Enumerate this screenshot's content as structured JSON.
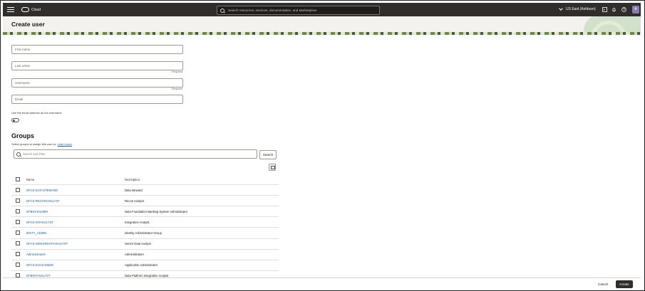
{
  "topbar": {
    "brand": "Cloud",
    "search_placeholder": "Search resources, services, documentation, and Marketplace",
    "region": "US East (Ashburn)",
    "avatar_initial": "A"
  },
  "page": {
    "title": "Create user"
  },
  "form": {
    "first_name_placeholder": "First name",
    "last_name_placeholder": "Last name",
    "last_name_required": "Required",
    "username_placeholder": "Username",
    "username_required": "Required",
    "email_placeholder": "Email",
    "use_email_label": "Use the email address as the username",
    "use_email_toggle_on": false
  },
  "groups": {
    "title": "Groups",
    "subtitle": "Select groups to assign this user to.",
    "learn_more": "Learn more",
    "search_placeholder": "Search and Filter",
    "search_button": "Search",
    "columns": {
      "name": "Name",
      "description": "Description"
    },
    "rows": [
      {
        "name": "DFCS-DATASTEWARD",
        "description": "Data steward"
      },
      {
        "name": "DFCS-RECONANALYST",
        "description": "Recon Analyst"
      },
      {
        "name": "DFBSYSADMIN",
        "description": "Data Foundation Banking System Administrator"
      },
      {
        "name": "DFCS-INTANALYST",
        "description": "Integration Analyst"
      },
      {
        "name": "IDNTY_ADMIN",
        "description": "Identity Administrator Group"
      },
      {
        "name": "DFCS-SENIORDATAANALYST",
        "description": "Senior Data Analyst"
      },
      {
        "name": "Administrators",
        "description": "Administrators"
      },
      {
        "name": "DFCS-DUAZADMIN",
        "description": "Application Administrator"
      },
      {
        "name": "DFBINTANALYST",
        "description": "Data Platform Integration Analyst"
      }
    ]
  },
  "footer": {
    "cancel": "Cancel",
    "create": "Create"
  }
}
